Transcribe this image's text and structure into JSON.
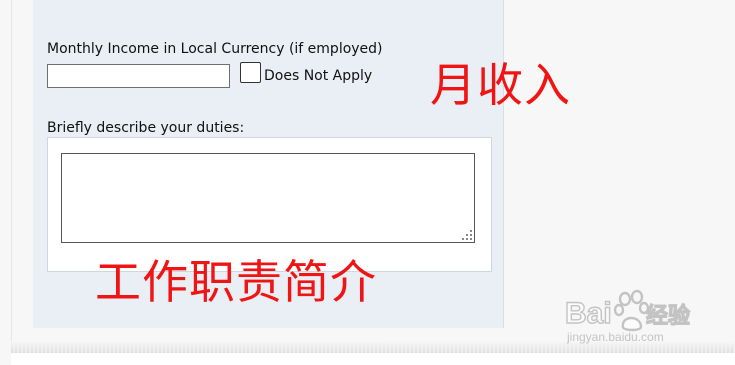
{
  "form": {
    "income_label": "Monthly Income in Local Currency (if employed)",
    "income_value": "",
    "does_not_apply_checked": false,
    "does_not_apply_label": "Does Not Apply",
    "duties_label": "Briefly describe your duties:",
    "duties_value": ""
  },
  "annotations": {
    "income": "月收入",
    "duties": "工作职责简介",
    "color": "#f01414"
  },
  "watermark": {
    "brand": "Baidu经验",
    "url": "jingyan.baidu.com"
  },
  "colors": {
    "panel_bg": "#e9eff5",
    "page_bg": "#f7f7f7"
  }
}
